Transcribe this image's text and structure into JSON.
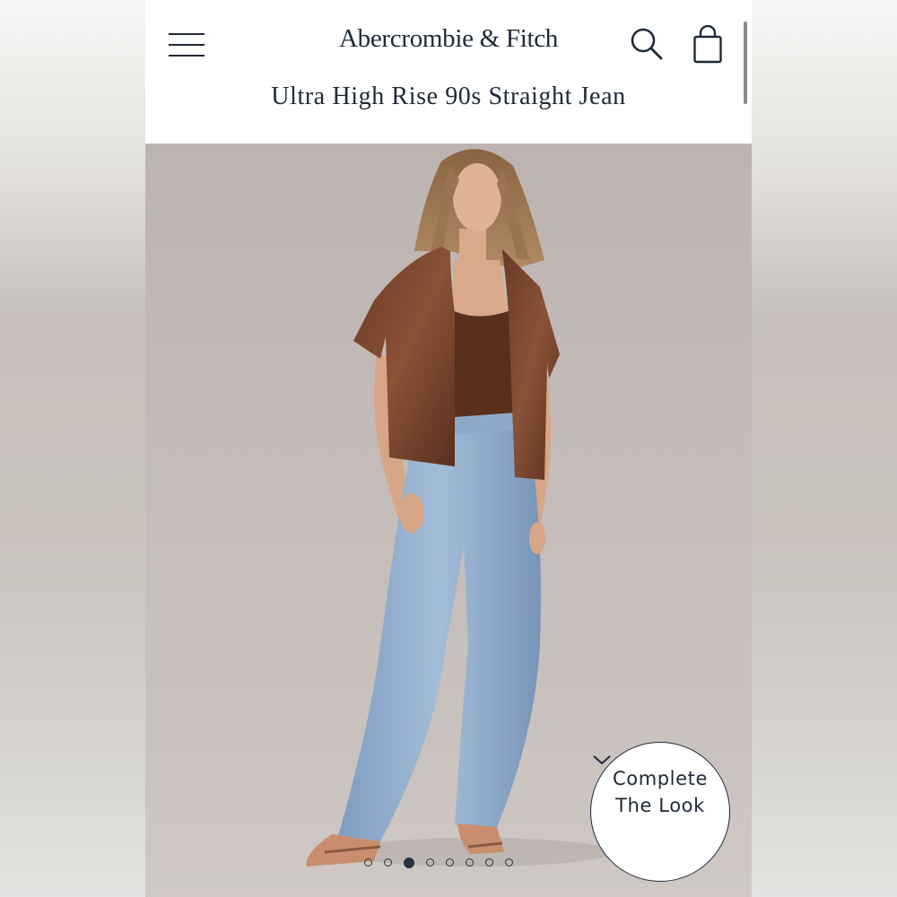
{
  "header": {
    "brand": "Abercrombie & Fitch",
    "product_title": "Ultra High Rise 90s Straight Jean"
  },
  "icons": {
    "menu": "hamburger-menu-icon",
    "search": "search-icon",
    "bag": "shopping-bag-icon",
    "chevron": "chevron-down-icon"
  },
  "carousel": {
    "total_images": 8,
    "active_index": 2
  },
  "complete_the_look": {
    "line1": "Complete",
    "line2": "The Look"
  },
  "colors": {
    "ink": "#1f2a37",
    "photo_background": "#c4bcb8"
  }
}
